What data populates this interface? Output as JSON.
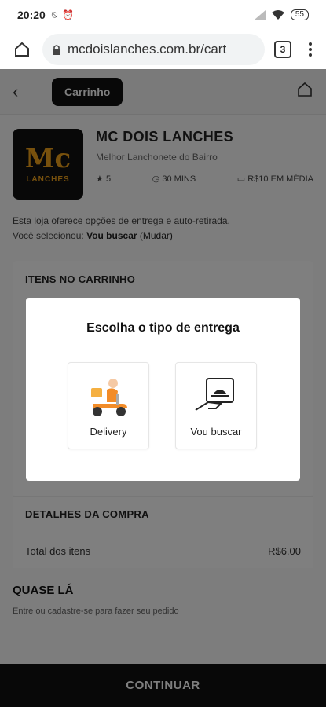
{
  "status_bar": {
    "time": "20:20",
    "battery": "55"
  },
  "browser": {
    "url": "mcdoislanches.com.br/cart",
    "tab_count": "3"
  },
  "header": {
    "cart_label": "Carrinho"
  },
  "store": {
    "logo_text": "Mc",
    "logo_subtext": "LANCHES",
    "name": "MC DOIS LANCHES",
    "subtitle": "Melhor Lanchonete do Bairro",
    "rating": "5",
    "time": "30 MINS",
    "average": "R$10 EM MÉDIA"
  },
  "delivery_note": {
    "line1": "Esta loja oferece opções de entrega e auto-retirada.",
    "selected_prefix": "Você selecionou:",
    "selected_value": "Vou buscar",
    "change_link": "(Mudar)"
  },
  "cart": {
    "title": "ITENS NO CARRINHO"
  },
  "details": {
    "title": "DETALHES DA COMPRA",
    "total_label": "Total dos itens",
    "total_value": "R$6.00"
  },
  "quase": {
    "title": "QUASE LÁ",
    "subtitle": "Entre ou cadastre-se para fazer seu pedido"
  },
  "continue_label": "CONTINUAR",
  "modal": {
    "title": "Escolha o tipo de entrega",
    "options": [
      {
        "label": "Delivery",
        "icon": "delivery-scooter-icon"
      },
      {
        "label": "Vou buscar",
        "icon": "pickup-bag-icon"
      }
    ]
  },
  "colors": {
    "accent": "#111111",
    "brand": "#f0a21a",
    "scooter": "#f28c28"
  }
}
